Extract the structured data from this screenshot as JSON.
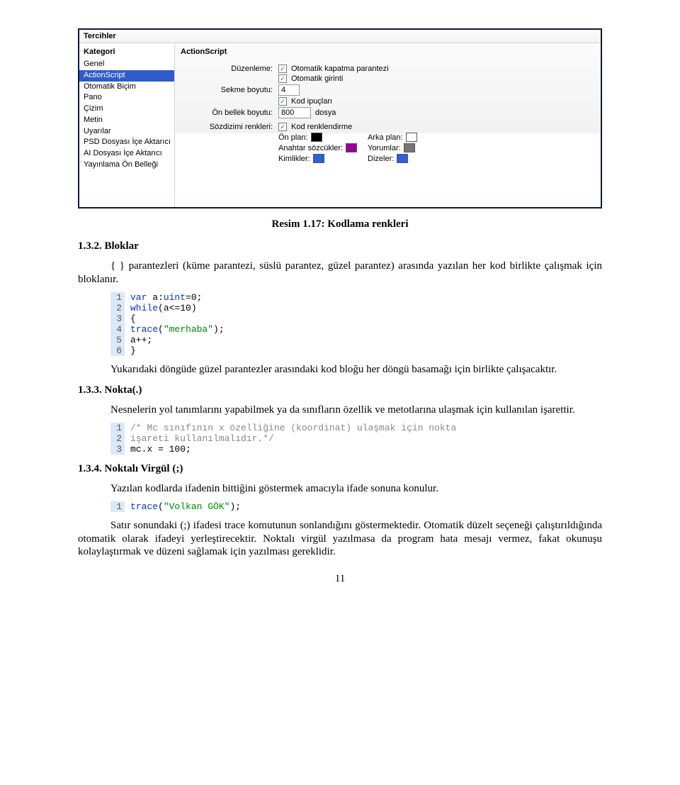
{
  "dialog": {
    "title": "Tercihler",
    "category_header": "Kategori",
    "categories": [
      "Genel",
      "ActionScript",
      "Otomatik Biçim",
      "Pano",
      "Çizim",
      "Metin",
      "Uyarılar",
      "PSD Dosyası İçe Aktarıcı",
      "AI Dosyası İçe Aktarıcı",
      "Yayınlama Ön Belleği"
    ],
    "selected_category": "ActionScript",
    "panel_header": "ActionScript",
    "labels": {
      "duzenleme": "Düzenleme:",
      "auto_paren": "Otomatik kapatma parantezi",
      "auto_indent": "Otomatik girinti",
      "tab_size": "Sekme boyutu:",
      "tab_size_val": "4",
      "code_hints": "Kod ipuçları",
      "cache_size": "Ön bellek boyutu:",
      "cache_val": "800",
      "cache_unit": "dosya",
      "syntax_colors": "Sözdizimi renkleri:",
      "code_coloring": "Kod renklendirme",
      "fg": "Ön plan:",
      "bg": "Arka plan:",
      "keywords": "Anahtar sözcükler:",
      "comments": "Yorumlar:",
      "identifiers": "Kimlikler:",
      "strings": "Dizeler:"
    },
    "swatches": {
      "fg": "#000000",
      "bg": "#ffffff",
      "keywords": "#990099",
      "comments": "#777777",
      "identifiers": "#2a5fdd",
      "strings": "#2a5fdd"
    }
  },
  "caption": "Resim 1.17: Kodlama renkleri",
  "sec132": {
    "heading": "1.3.2. Bloklar",
    "para1": "{   } parantezleri (küme parantezi, süslü parantez, güzel parantez) arasında yazılan her kod birlikte çalışmak için bloklanır.",
    "code1": [
      {
        "n": "1",
        "html": "<span class='tok-kw'>var</span> <span class='tok-txt'>a:</span><span class='tok-type'>uint</span><span class='tok-txt'>=0;</span>"
      },
      {
        "n": "2",
        "html": "<span class='tok-kw'>while</span><span class='tok-txt'>(a&lt;=10)</span>"
      },
      {
        "n": "3",
        "html": "<span class='tok-txt'>{</span>"
      },
      {
        "n": "4",
        "html": "<span class='tok-fn'>trace</span><span class='tok-txt'>(</span><span class='tok-str'>\"merhaba\"</span><span class='tok-txt'>);</span>"
      },
      {
        "n": "5",
        "html": "<span class='tok-txt'>a++;</span>"
      },
      {
        "n": "6",
        "html": "<span class='tok-txt'>}</span>"
      }
    ],
    "para2": "Yukarıdaki döngüde güzel parantezler arasındaki kod bloğu her döngü basamağı için birlikte çalışacaktır."
  },
  "sec133": {
    "heading": "1.3.3. Nokta(.)",
    "para1": "Nesnelerin yol tanımlarını yapabilmek ya da sınıfların özellik ve metotlarına ulaşmak için kullanılan işarettir.",
    "code1": [
      {
        "n": "1",
        "html": "<span class='tok-cm'>/* Mc sınıfının x özelliğine (koordinat) ulaşmak için nokta</span>"
      },
      {
        "n": "2",
        "html": "<span class='tok-cm'>işareti kullanılmalıdır.*/</span>"
      },
      {
        "n": "3",
        "html": "<span class='tok-txt'>mc.x = 100;</span>"
      }
    ]
  },
  "sec134": {
    "heading": "1.3.4. Noktalı Virgül (;)",
    "para1": "Yazılan kodlarda ifadenin bittiğini göstermek amacıyla ifade sonuna konulur.",
    "code1": [
      {
        "n": "1",
        "html": "<span class='tok-fn'>trace</span><span class='tok-txt'>(</span><span class='tok-str'>\"Volkan GÖK\"</span><span class='tok-txt'>);</span>"
      }
    ],
    "para2": "Satır sonundaki (;) ifadesi trace komutunun sonlandığını göstermektedir. Otomatik düzelt seçeneği çalıştırıldığında otomatik olarak ifadeyi yerleştirecektir. Noktalı virgül yazılmasa da program hata mesajı vermez, fakat okunuşu kolaylaştırmak ve düzeni sağlamak için yazılması gereklidir."
  },
  "pagenum": "11"
}
